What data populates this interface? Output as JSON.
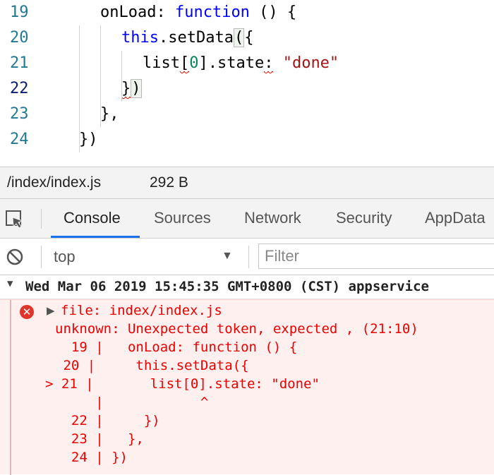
{
  "editor": {
    "lines": [
      {
        "num": "19",
        "active": false,
        "tokens": [
          {
            "t": "onLoad: ",
            "c": "plain"
          },
          {
            "t": "function",
            "c": "kw"
          },
          {
            "t": " () {",
            "c": "plain"
          }
        ]
      },
      {
        "num": "20",
        "active": false,
        "tokens": [
          {
            "t": "this",
            "c": "kw"
          },
          {
            "t": ".setData",
            "c": "plain"
          },
          {
            "t": "(",
            "c": "plain",
            "box": true
          },
          {
            "t": "{",
            "c": "plain"
          }
        ]
      },
      {
        "num": "21",
        "active": false,
        "tokens": [
          {
            "t": "list",
            "c": "plain"
          },
          {
            "t": "[",
            "c": "plain",
            "squiggle": true
          },
          {
            "t": "0",
            "c": "num"
          },
          {
            "t": "].state",
            "c": "plain"
          },
          {
            "t": ":",
            "c": "plain",
            "squiggle": true
          },
          {
            "t": " ",
            "c": "plain"
          },
          {
            "t": "\"done\"",
            "c": "str"
          }
        ]
      },
      {
        "num": "22",
        "active": true,
        "tokens": [
          {
            "t": "}",
            "c": "plain",
            "squiggle": true
          },
          {
            "t": ")",
            "c": "plain",
            "box": true
          }
        ]
      },
      {
        "num": "23",
        "active": false,
        "tokens": [
          {
            "t": "},",
            "c": "plain"
          }
        ]
      },
      {
        "num": "24",
        "active": false,
        "tokens": [
          {
            "t": "})",
            "c": "plain"
          }
        ]
      }
    ]
  },
  "filebar": {
    "path": "/index/index.js",
    "size": "292 B"
  },
  "tabs": [
    "Console",
    "Sources",
    "Network",
    "Security",
    "AppData"
  ],
  "active_tab": "Console",
  "toolbar": {
    "context": "top",
    "filter_placeholder": "Filter"
  },
  "group_header": "Wed Mar 06 2019 15:45:35 GMT+0800 (CST)  appservice",
  "error": {
    "lines": [
      "file: index/index.js",
      "unknown: Unexpected token, expected , (21:10)",
      "  19 |   onLoad: function () {",
      " 20 |     this.setData({",
      "> 21 |       list[0].state: \"done\"",
      "     |            ^",
      "  22 |     })",
      "  23 |   },",
      "  24 | })"
    ]
  }
}
